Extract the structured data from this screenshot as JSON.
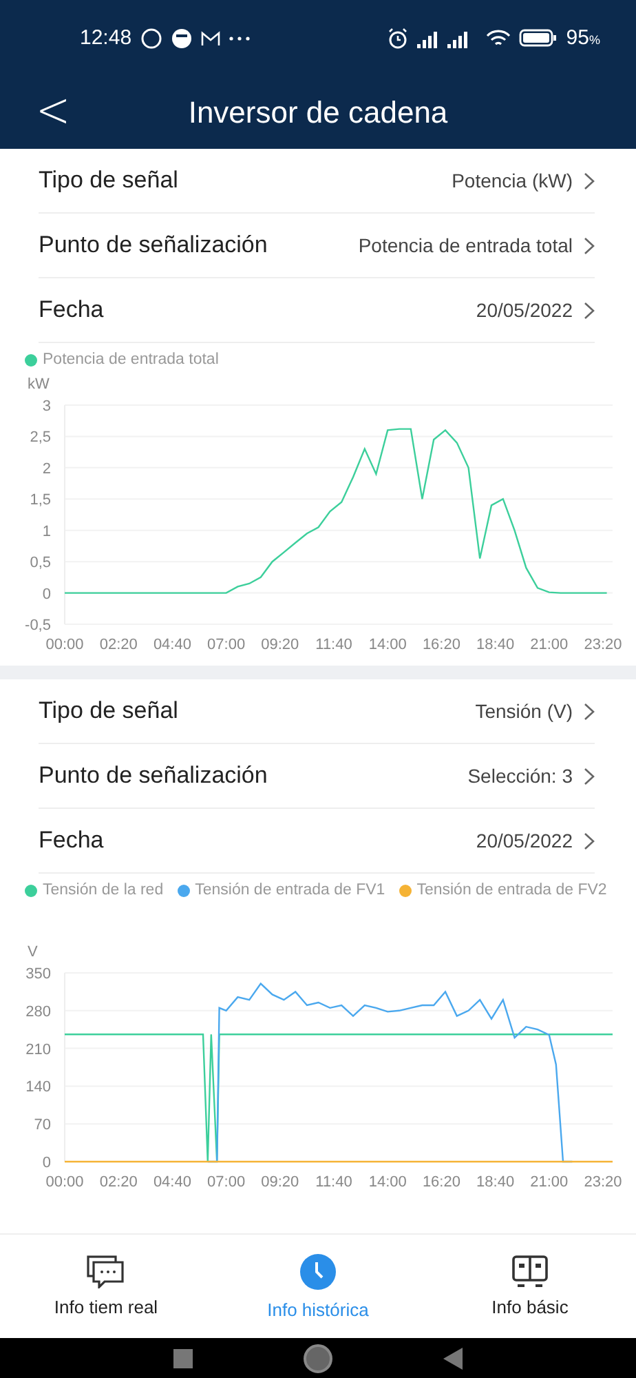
{
  "status_bar": {
    "time": "12:48",
    "battery": "95",
    "battery_unit": "%"
  },
  "header": {
    "back": "<",
    "title": "Inversor de cadena"
  },
  "sections": [
    {
      "rows": [
        {
          "label": "Tipo de señal",
          "value": "Potencia (kW)"
        },
        {
          "label": "Punto de señalización",
          "value": "Potencia de entrada total"
        },
        {
          "label": "Fecha",
          "value": "20/05/2022"
        }
      ],
      "chart_data": {
        "type": "line",
        "grid": true,
        "ylabel": "kW",
        "xlim": [
          0,
          23.75
        ],
        "ylim": [
          -0.5,
          3
        ],
        "x": [
          0,
          0.5,
          1,
          1.5,
          2,
          2.5,
          3,
          3.5,
          4,
          4.5,
          5,
          5.5,
          6,
          6.5,
          7,
          7.5,
          8,
          8.5,
          9,
          9.5,
          10,
          10.5,
          11,
          11.5,
          12,
          12.5,
          13,
          13.5,
          14,
          14.5,
          15,
          15.5,
          16,
          16.5,
          17,
          17.5,
          18,
          18.5,
          19,
          19.5,
          20,
          20.5,
          21,
          21.5,
          22,
          22.5,
          23,
          23.5
        ],
        "series": [
          {
            "name": "Potencia de entrada total",
            "color": "#3ccf9b",
            "values": [
              0,
              0,
              0,
              0,
              0,
              0,
              0,
              0,
              0,
              0,
              0,
              0,
              0,
              0,
              0,
              0.1,
              0.15,
              0.25,
              0.5,
              0.65,
              0.8,
              0.95,
              1.05,
              1.3,
              1.45,
              1.85,
              2.3,
              1.9,
              2.6,
              2.62,
              2.62,
              1.5,
              2.45,
              2.6,
              2.4,
              2.0,
              0.55,
              1.4,
              1.5,
              1.0,
              0.4,
              0.08,
              0.01,
              0,
              0,
              0,
              0,
              0
            ]
          }
        ],
        "xticks": [
          {
            "value": 0,
            "label": "00:00"
          },
          {
            "value": 2.333,
            "label": "02:20"
          },
          {
            "value": 4.667,
            "label": "04:40"
          },
          {
            "value": 7,
            "label": "07:00"
          },
          {
            "value": 9.333,
            "label": "09:20"
          },
          {
            "value": 11.667,
            "label": "11:40"
          },
          {
            "value": 14,
            "label": "14:00"
          },
          {
            "value": 16.333,
            "label": "16:20"
          },
          {
            "value": 18.667,
            "label": "18:40"
          },
          {
            "value": 21,
            "label": "21:00"
          },
          {
            "value": 23.333,
            "label": "23:20"
          }
        ],
        "yticks": [
          {
            "value": -0.5,
            "label": "-0,5"
          },
          {
            "value": 0,
            "label": "0"
          },
          {
            "value": 0.5,
            "label": "0,5"
          },
          {
            "value": 1,
            "label": "1"
          },
          {
            "value": 1.5,
            "label": "1,5"
          },
          {
            "value": 2,
            "label": "2"
          },
          {
            "value": 2.5,
            "label": "2,5"
          },
          {
            "value": 3,
            "label": "3"
          }
        ]
      }
    },
    {
      "rows": [
        {
          "label": "Tipo de señal",
          "value": "Tensión (V)"
        },
        {
          "label": "Punto de señalización",
          "value": "Selección: 3"
        },
        {
          "label": "Fecha",
          "value": "20/05/2022"
        }
      ],
      "chart_data": {
        "type": "line",
        "grid": true,
        "ylabel": "V",
        "xlim": [
          0,
          23.75
        ],
        "ylim": [
          0,
          350
        ],
        "x": [
          0,
          1,
          2,
          3,
          4,
          5,
          6,
          6.2,
          6.35,
          6.6,
          6.7,
          7,
          7.5,
          8,
          8.5,
          9,
          9.5,
          10,
          10.5,
          11,
          11.5,
          12,
          12.5,
          13,
          13.5,
          14,
          14.5,
          15,
          15.5,
          16,
          16.5,
          17,
          17.5,
          18,
          18.5,
          19,
          19.5,
          20,
          20.5,
          21,
          21.3,
          21.6,
          22,
          23,
          23.75
        ],
        "series": [
          {
            "name": "Tensión de la red",
            "color": "#3ccf9b",
            "values": [
              236,
              236,
              236,
              236,
              236,
              236,
              236,
              0,
              236,
              0,
              236,
              236,
              236,
              236,
              236,
              236,
              236,
              236,
              236,
              236,
              236,
              236,
              236,
              236,
              236,
              236,
              236,
              236,
              236,
              236,
              236,
              236,
              236,
              236,
              236,
              236,
              236,
              236,
              236,
              236,
              236,
              236,
              236,
              236,
              236
            ]
          },
          {
            "name": "Tensión de entrada de FV1",
            "color": "#4aa8ee",
            "values": [
              null,
              null,
              null,
              null,
              null,
              null,
              null,
              0,
              0,
              0,
              285,
              280,
              305,
              300,
              330,
              310,
              300,
              315,
              290,
              295,
              285,
              290,
              270,
              290,
              285,
              278,
              280,
              285,
              290,
              290,
              315,
              270,
              280,
              300,
              265,
              300,
              230,
              250,
              245,
              235,
              180,
              0,
              0,
              null,
              null
            ]
          },
          {
            "name": "Tensión de entrada de FV2",
            "color": "#f5b335",
            "values": [
              0,
              0,
              0,
              0,
              0,
              0,
              0,
              0,
              0,
              0,
              0,
              0,
              0,
              0,
              0,
              0,
              0,
              0,
              0,
              0,
              0,
              0,
              0,
              0,
              0,
              0,
              0,
              0,
              0,
              0,
              0,
              0,
              0,
              0,
              0,
              0,
              0,
              0,
              0,
              0,
              0,
              0,
              0,
              0,
              0
            ]
          }
        ],
        "xticks": [
          {
            "value": 0,
            "label": "00:00"
          },
          {
            "value": 2.333,
            "label": "02:20"
          },
          {
            "value": 4.667,
            "label": "04:40"
          },
          {
            "value": 7,
            "label": "07:00"
          },
          {
            "value": 9.333,
            "label": "09:20"
          },
          {
            "value": 11.667,
            "label": "11:40"
          },
          {
            "value": 14,
            "label": "14:00"
          },
          {
            "value": 16.333,
            "label": "16:20"
          },
          {
            "value": 18.667,
            "label": "18:40"
          },
          {
            "value": 21,
            "label": "21:00"
          },
          {
            "value": 23.333,
            "label": "23:20"
          }
        ],
        "yticks": [
          0,
          70,
          140,
          210,
          280,
          350
        ]
      }
    }
  ],
  "bottom_nav": [
    {
      "kind": "chat",
      "label": "Info tiem real",
      "selected": false
    },
    {
      "kind": "clock",
      "label": "Info histórica",
      "selected": true
    },
    {
      "kind": "device",
      "label": "Info básic",
      "selected": false
    }
  ]
}
